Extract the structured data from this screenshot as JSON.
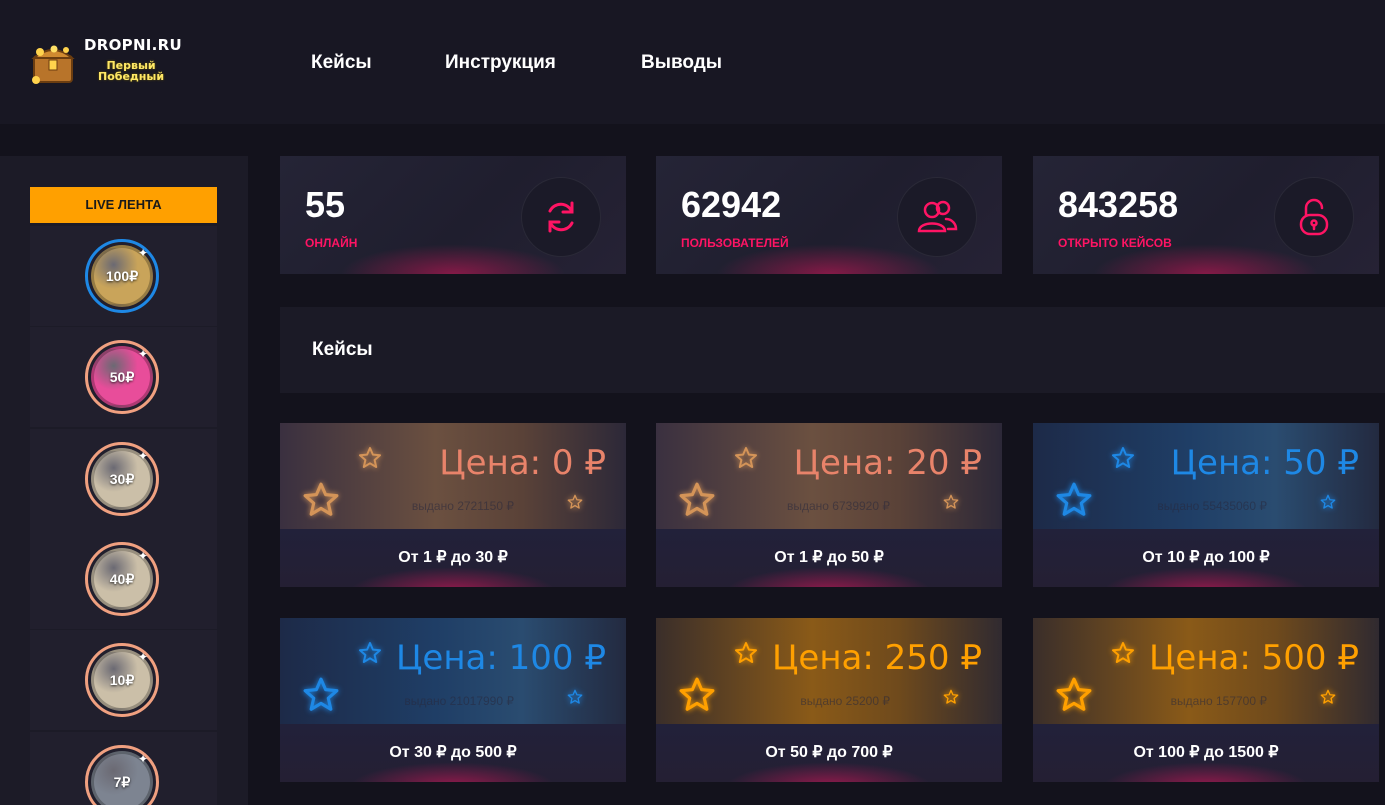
{
  "header": {
    "logo_title": "DROPNI.RU",
    "logo_sub_line1": "Первый",
    "logo_sub_line2": "Победный",
    "nav": [
      {
        "label": "Кейсы"
      },
      {
        "label": "Инструкция"
      },
      {
        "label": "Выводы"
      }
    ]
  },
  "sidebar": {
    "title": "LIVE ЛЕНТА",
    "items": [
      {
        "coin": "100₽",
        "color": "#c9a45a",
        "ring": "#1e88e5"
      },
      {
        "coin": "50₽",
        "color": "#e84d9a",
        "ring": "#f0a080"
      },
      {
        "coin": "30₽",
        "color": "#cbbfa8",
        "ring": "#f0a080"
      },
      {
        "coin": "40₽",
        "color": "#cbbfa8",
        "ring": "#f0a080"
      },
      {
        "coin": "10₽",
        "color": "#cbbfa8",
        "ring": "#f0a080"
      },
      {
        "coin": "7₽",
        "color": "#7d8491",
        "ring": "#f0a080"
      }
    ]
  },
  "stats": [
    {
      "value": "55",
      "label": "ОНЛАЙН",
      "icon": "refresh-icon"
    },
    {
      "value": "62942",
      "label": "ПОЛЬЗОВАТЕЛЕЙ",
      "icon": "users-icon"
    },
    {
      "value": "843258",
      "label": "ОТКРЫТО КЕЙСОВ",
      "icon": "unlock-icon"
    }
  ],
  "section_title": "Кейсы",
  "cases": [
    {
      "price": "Цена: 0 ₽",
      "issued": "выдано 2721150 ₽",
      "range": "От 1 ₽ до 30 ₽",
      "theme": "bronze",
      "price_color": "#e8836a",
      "star_color": "#d49458"
    },
    {
      "price": "Цена: 20 ₽",
      "issued": "выдано 6739920 ₽",
      "range": "От 1 ₽ до 50 ₽",
      "theme": "bronze",
      "price_color": "#e8836a",
      "star_color": "#d49458"
    },
    {
      "price": "Цена: 50 ₽",
      "issued": "выдано 55435060 ₽",
      "range": "От 10 ₽ до 100 ₽",
      "theme": "blue",
      "price_color": "#1e88e5",
      "star_color": "#1e88e5"
    },
    {
      "price": "Цена: 100 ₽",
      "issued": "выдано 21017990 ₽",
      "range": "От 30 ₽ до 500 ₽",
      "theme": "blue",
      "price_color": "#1e88e5",
      "star_color": "#1e88e5"
    },
    {
      "price": "Цена: 250 ₽",
      "issued": "выдано 25200 ₽",
      "range": "От 50 ₽ до 700 ₽",
      "theme": "orange",
      "price_color": "#ffa000",
      "star_color": "#ffa000"
    },
    {
      "price": "Цена: 500 ₽",
      "issued": "выдано 157700 ₽",
      "range": "От 100 ₽ до 1500 ₽",
      "theme": "orange",
      "price_color": "#ffa000",
      "star_color": "#ffa000"
    }
  ]
}
